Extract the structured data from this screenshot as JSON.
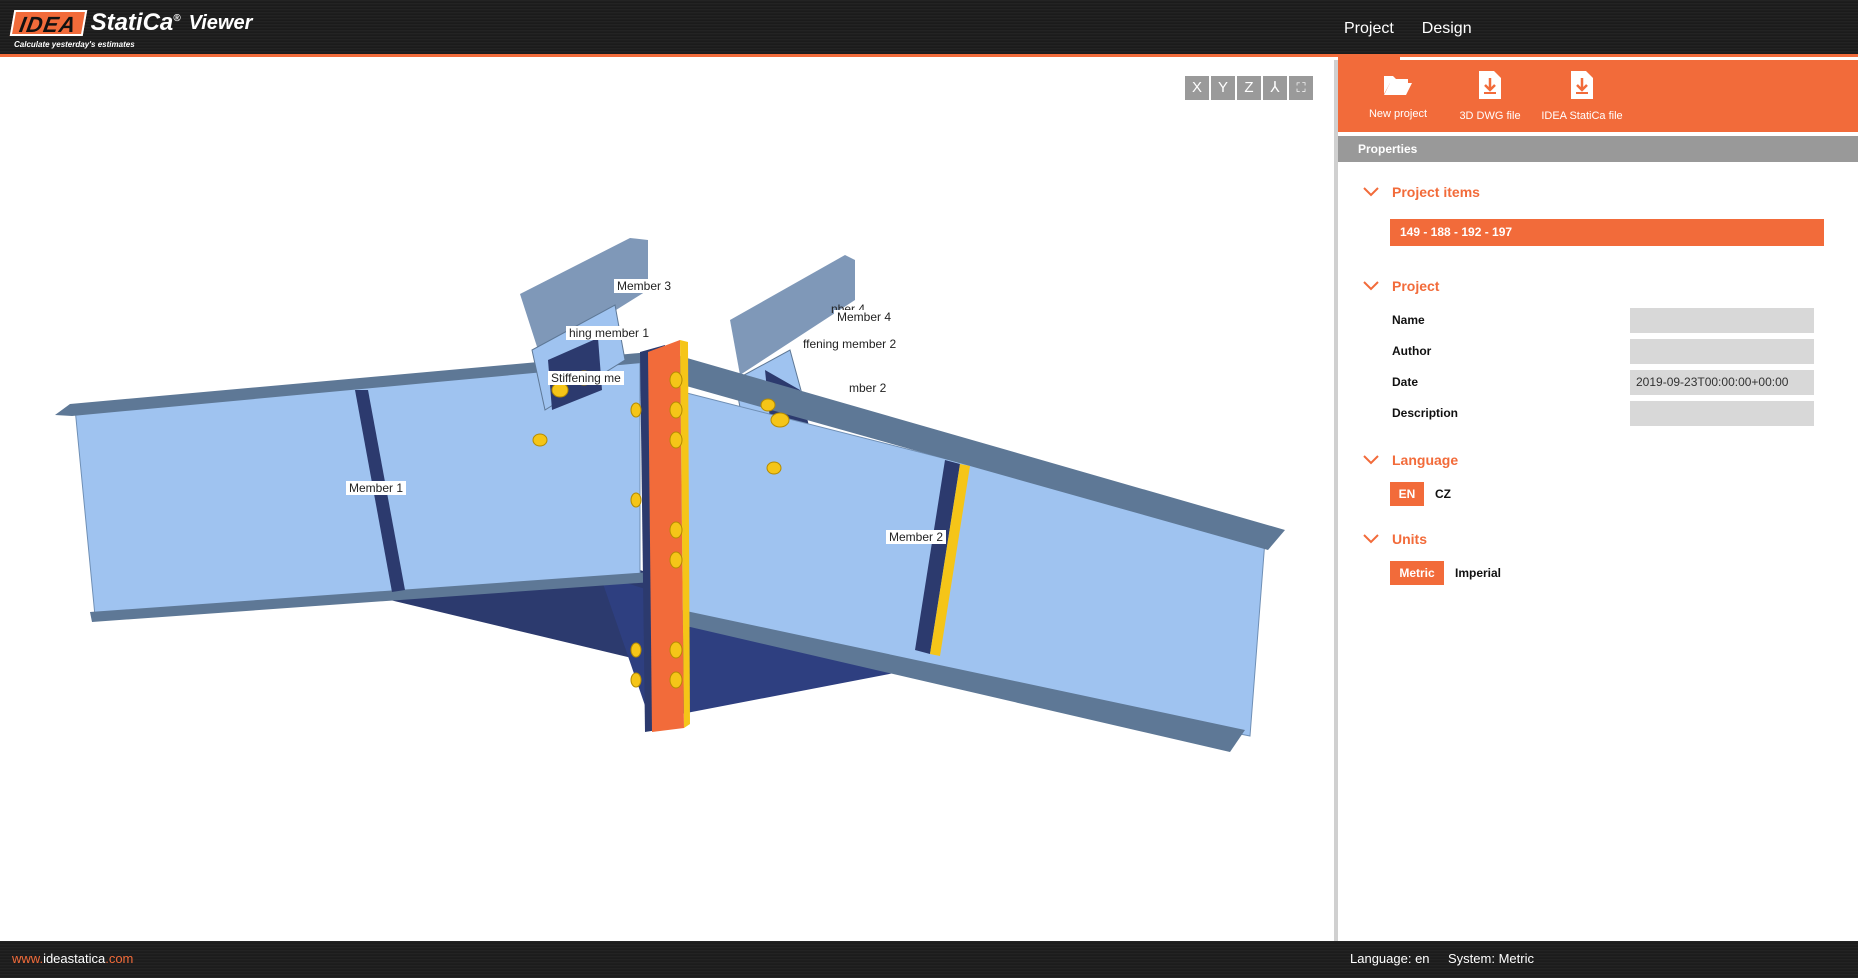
{
  "app": {
    "logo_box": "IDEA",
    "logo_word": "StatiCa",
    "logo_reg": "®",
    "logo_viewer": "Viewer",
    "tagline": "Calculate yesterday's estimates"
  },
  "nav": {
    "tabs": [
      {
        "label": "Project"
      },
      {
        "label": "Design"
      }
    ]
  },
  "view_controls": [
    "X",
    "Y",
    "Z",
    "⅄",
    "⛶"
  ],
  "model": {
    "labels": [
      "Member 3",
      "hing member 1",
      "Stiffening me",
      "nber 4",
      "Member 4",
      "ffening member 2",
      "mber 2",
      "Member 1",
      "Member 2"
    ]
  },
  "ribbon": {
    "buttons": [
      {
        "label": "New project",
        "icon": "folder-open-icon"
      },
      {
        "label": "3D DWG file",
        "icon": "file-download-icon"
      },
      {
        "label": "IDEA StatiCa file",
        "icon": "file-download-icon"
      }
    ]
  },
  "properties": {
    "title": "Properties",
    "project_items": {
      "heading": "Project items",
      "selected": "149 - 188 - 192 - 197"
    },
    "project": {
      "heading": "Project",
      "fields": [
        {
          "label": "Name",
          "value": ""
        },
        {
          "label": "Author",
          "value": ""
        },
        {
          "label": "Date",
          "value": "2019-09-23T00:00:00+00:00"
        },
        {
          "label": "Description",
          "value": ""
        }
      ]
    },
    "language": {
      "heading": "Language",
      "options": [
        "EN",
        "CZ"
      ],
      "selected": "EN"
    },
    "units": {
      "heading": "Units",
      "options": [
        "Metric",
        "Imperial"
      ],
      "selected": "Metric"
    }
  },
  "footer": {
    "link_prefix": "www.",
    "link_main": "ideastatica",
    "link_suffix": ".com",
    "language_status": "Language: en",
    "system_status": "System: Metric"
  },
  "colors": {
    "accent": "#f26b3a",
    "beam_web": "#9fc3f0",
    "beam_flange": "#5e7896",
    "plate_dark": "#2c3a6e",
    "bolt": "#f5c518"
  }
}
